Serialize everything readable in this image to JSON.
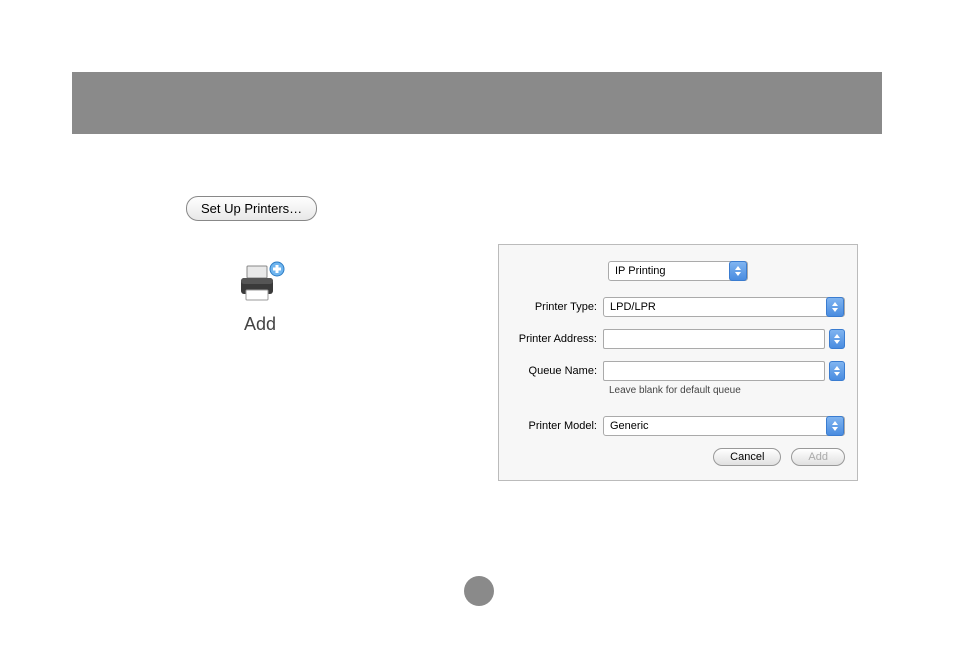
{
  "setup_button_label": "Set Up Printers…",
  "add_icon_label": "Add",
  "dialog": {
    "top_dropdown_value": "IP Printing",
    "printer_type_label": "Printer Type:",
    "printer_type_value": "LPD/LPR",
    "printer_address_label": "Printer Address:",
    "printer_address_value": "",
    "queue_name_label": "Queue Name:",
    "queue_name_value": "",
    "queue_hint": "Leave blank for default queue",
    "printer_model_label": "Printer Model:",
    "printer_model_value": "Generic",
    "cancel_label": "Cancel",
    "add_label": "Add"
  }
}
